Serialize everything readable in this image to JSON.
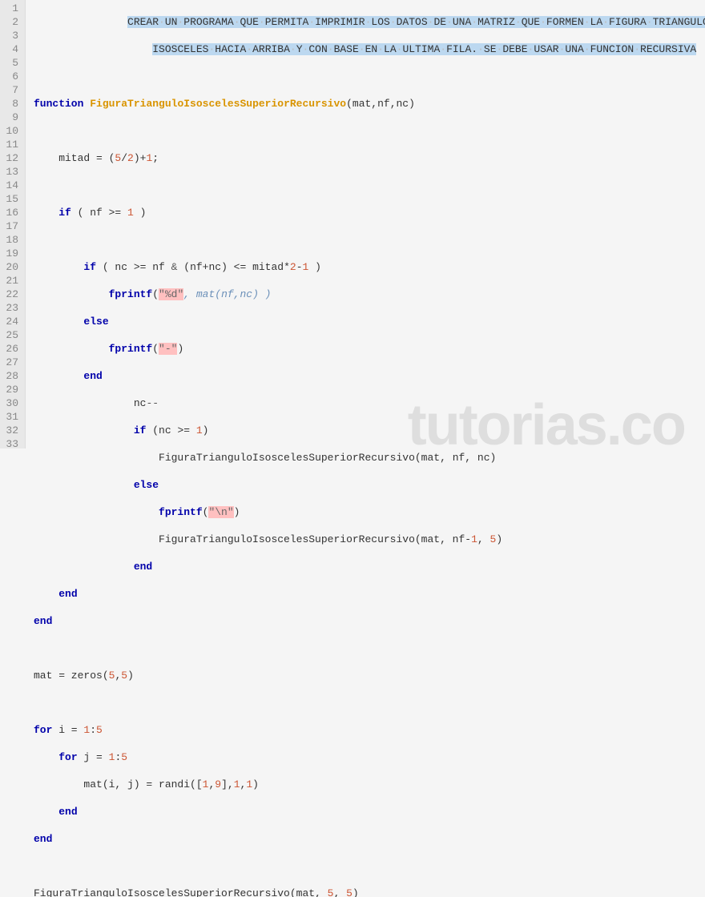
{
  "gutter": [
    "1",
    "2",
    "3",
    "4",
    "5",
    "6",
    "7",
    "8",
    "9",
    "10",
    "11",
    "12",
    "13",
    "14",
    "15",
    "16",
    "17",
    "18",
    "19",
    "20",
    "21",
    "22",
    "23",
    "24",
    "25",
    "26",
    "27",
    "28",
    "29",
    "30",
    "31",
    "32",
    "33"
  ],
  "comment1": "CREAR UN PROGRAMA QUE PERMITA IMPRIMIR LOS DATOS DE UNA MATRIZ QUE FORMEN LA FIGURA TRIANGULO",
  "comment2": "ISOSCELES HACIA ARRIBA Y CON BASE EN LA ULTIMA FILA. SE DEBE USAR UNA FUNCION RECURSIVA",
  "tokens": {
    "function": "function",
    "fnname": "FiguraTrianguloIsoscelesSuperiorRecursivo",
    "if": "if",
    "else": "else",
    "end": "end",
    "for": "for",
    "fprintf": "fprintf"
  },
  "code": {
    "l4_params": "(mat,nf,nc)",
    "l6": "mitad = (5/2)+1;",
    "l8_cond": "( nf >= 1 )",
    "l10_cond": "( nc >= nf & (nf+nc) <= mitad*2-1 )",
    "l11_str": "\"%d\"",
    "l11_arg": ", mat(nf,nc) )",
    "l13_str": "\"-\"",
    "l15": "nc--",
    "l16_cond": "(nc >= 1)",
    "l17_call": "FiguraTrianguloIsoscelesSuperiorRecursivo(mat, nf, nc)",
    "l19_str": "\"\\n\"",
    "l20_call": "FiguraTrianguloIsoscelesSuperiorRecursivo(mat, nf-1, 5)",
    "l25": "mat = zeros(5,5)",
    "l27": "for i = 1:5",
    "l28": "for j = 1:5",
    "l29": "mat(i, j) = randi([1,9],1,1)",
    "l33": "FiguraTrianguloIsoscelesSuperiorRecursivo(mat, 5, 5)"
  },
  "watermark": "tutorias.co"
}
